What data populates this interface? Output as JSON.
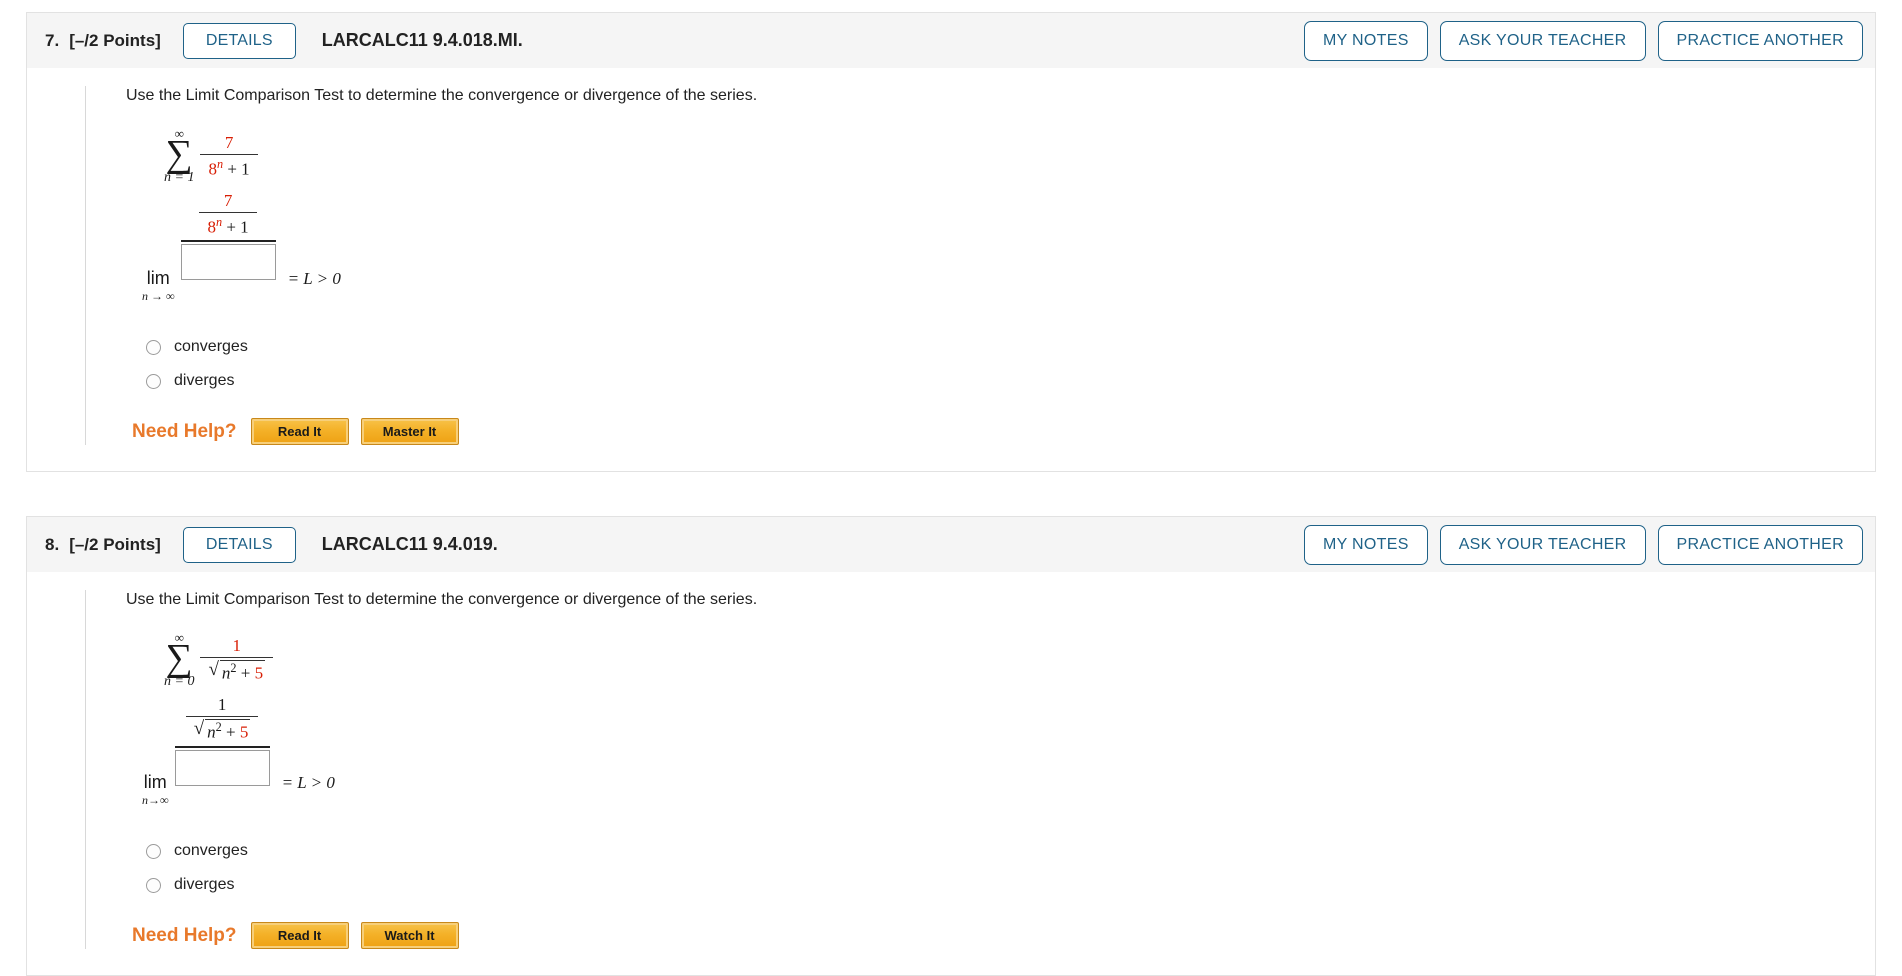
{
  "questions": [
    {
      "number": "7.",
      "points": "[–/2 Points]",
      "details_label": "DETAILS",
      "code": "LARCALC11 9.4.018.MI.",
      "actions": [
        {
          "label": "MY NOTES"
        },
        {
          "label": "ASK YOUR TEACHER"
        },
        {
          "label": "PRACTICE ANOTHER"
        }
      ],
      "prompt": "Use the Limit Comparison Test to determine the convergence or divergence of the series.",
      "series": {
        "sigma_top": "∞",
        "sigma_bottom": "n = 1",
        "numerator": "7",
        "denominator_base": "8",
        "denominator_exponent": "n",
        "denominator_tail": "+ 1"
      },
      "limit": {
        "lim_word": "lim",
        "lim_sub": "n → ∞",
        "numerator": "7",
        "denominator_base": "8",
        "denominator_exponent": "n",
        "denominator_tail": "+ 1",
        "answer_value": "",
        "answer_placeholder": "",
        "tail": "= L > 0"
      },
      "options": [
        {
          "label": "converges"
        },
        {
          "label": "diverges"
        }
      ],
      "need_help_label": "Need Help?",
      "help_buttons": [
        {
          "label": "Read It"
        },
        {
          "label": "Master It"
        }
      ]
    },
    {
      "number": "8.",
      "points": "[–/2 Points]",
      "details_label": "DETAILS",
      "code": "LARCALC11 9.4.019.",
      "actions": [
        {
          "label": "MY NOTES"
        },
        {
          "label": "ASK YOUR TEACHER"
        },
        {
          "label": "PRACTICE ANOTHER"
        }
      ],
      "prompt": "Use the Limit Comparison Test to determine the convergence or divergence of the series.",
      "series": {
        "sigma_top": "∞",
        "sigma_bottom": "n = 0",
        "numerator": "1",
        "radicand_var": "n",
        "radicand_exponent": "2",
        "radicand_tail_op": "+",
        "radicand_tail_num": "5"
      },
      "limit": {
        "lim_word": "lim",
        "lim_sub": "n→∞",
        "numerator": "1",
        "radicand_var": "n",
        "radicand_exponent": "2",
        "radicand_tail_op": "+",
        "radicand_tail_num": "5",
        "answer_value": "",
        "answer_placeholder": "",
        "tail": "= L > 0"
      },
      "options": [
        {
          "label": "converges"
        },
        {
          "label": "diverges"
        }
      ],
      "need_help_label": "Need Help?",
      "help_buttons": [
        {
          "label": "Read It"
        },
        {
          "label": "Watch It"
        }
      ]
    }
  ],
  "colors": {
    "accent_blue": "#1f6288",
    "red_math": "#d81e05",
    "orange": "#e8792b",
    "header_bg": "#f5f5f5"
  }
}
